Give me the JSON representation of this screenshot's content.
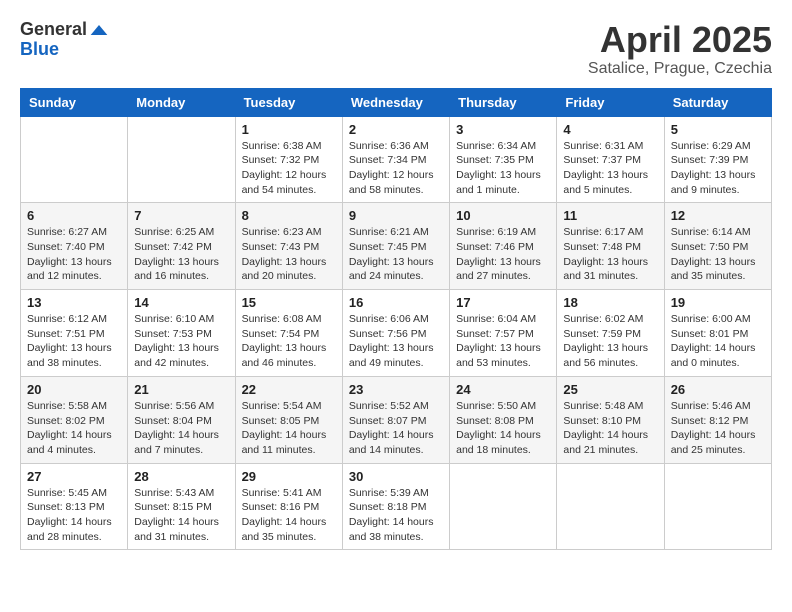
{
  "logo": {
    "general": "General",
    "blue": "Blue"
  },
  "title": "April 2025",
  "subtitle": "Satalice, Prague, Czechia",
  "days_of_week": [
    "Sunday",
    "Monday",
    "Tuesday",
    "Wednesday",
    "Thursday",
    "Friday",
    "Saturday"
  ],
  "weeks": [
    [
      {
        "day": "",
        "info": ""
      },
      {
        "day": "",
        "info": ""
      },
      {
        "day": "1",
        "info": "Sunrise: 6:38 AM\nSunset: 7:32 PM\nDaylight: 12 hours and 54 minutes."
      },
      {
        "day": "2",
        "info": "Sunrise: 6:36 AM\nSunset: 7:34 PM\nDaylight: 12 hours and 58 minutes."
      },
      {
        "day": "3",
        "info": "Sunrise: 6:34 AM\nSunset: 7:35 PM\nDaylight: 13 hours and 1 minute."
      },
      {
        "day": "4",
        "info": "Sunrise: 6:31 AM\nSunset: 7:37 PM\nDaylight: 13 hours and 5 minutes."
      },
      {
        "day": "5",
        "info": "Sunrise: 6:29 AM\nSunset: 7:39 PM\nDaylight: 13 hours and 9 minutes."
      }
    ],
    [
      {
        "day": "6",
        "info": "Sunrise: 6:27 AM\nSunset: 7:40 PM\nDaylight: 13 hours and 12 minutes."
      },
      {
        "day": "7",
        "info": "Sunrise: 6:25 AM\nSunset: 7:42 PM\nDaylight: 13 hours and 16 minutes."
      },
      {
        "day": "8",
        "info": "Sunrise: 6:23 AM\nSunset: 7:43 PM\nDaylight: 13 hours and 20 minutes."
      },
      {
        "day": "9",
        "info": "Sunrise: 6:21 AM\nSunset: 7:45 PM\nDaylight: 13 hours and 24 minutes."
      },
      {
        "day": "10",
        "info": "Sunrise: 6:19 AM\nSunset: 7:46 PM\nDaylight: 13 hours and 27 minutes."
      },
      {
        "day": "11",
        "info": "Sunrise: 6:17 AM\nSunset: 7:48 PM\nDaylight: 13 hours and 31 minutes."
      },
      {
        "day": "12",
        "info": "Sunrise: 6:14 AM\nSunset: 7:50 PM\nDaylight: 13 hours and 35 minutes."
      }
    ],
    [
      {
        "day": "13",
        "info": "Sunrise: 6:12 AM\nSunset: 7:51 PM\nDaylight: 13 hours and 38 minutes."
      },
      {
        "day": "14",
        "info": "Sunrise: 6:10 AM\nSunset: 7:53 PM\nDaylight: 13 hours and 42 minutes."
      },
      {
        "day": "15",
        "info": "Sunrise: 6:08 AM\nSunset: 7:54 PM\nDaylight: 13 hours and 46 minutes."
      },
      {
        "day": "16",
        "info": "Sunrise: 6:06 AM\nSunset: 7:56 PM\nDaylight: 13 hours and 49 minutes."
      },
      {
        "day": "17",
        "info": "Sunrise: 6:04 AM\nSunset: 7:57 PM\nDaylight: 13 hours and 53 minutes."
      },
      {
        "day": "18",
        "info": "Sunrise: 6:02 AM\nSunset: 7:59 PM\nDaylight: 13 hours and 56 minutes."
      },
      {
        "day": "19",
        "info": "Sunrise: 6:00 AM\nSunset: 8:01 PM\nDaylight: 14 hours and 0 minutes."
      }
    ],
    [
      {
        "day": "20",
        "info": "Sunrise: 5:58 AM\nSunset: 8:02 PM\nDaylight: 14 hours and 4 minutes."
      },
      {
        "day": "21",
        "info": "Sunrise: 5:56 AM\nSunset: 8:04 PM\nDaylight: 14 hours and 7 minutes."
      },
      {
        "day": "22",
        "info": "Sunrise: 5:54 AM\nSunset: 8:05 PM\nDaylight: 14 hours and 11 minutes."
      },
      {
        "day": "23",
        "info": "Sunrise: 5:52 AM\nSunset: 8:07 PM\nDaylight: 14 hours and 14 minutes."
      },
      {
        "day": "24",
        "info": "Sunrise: 5:50 AM\nSunset: 8:08 PM\nDaylight: 14 hours and 18 minutes."
      },
      {
        "day": "25",
        "info": "Sunrise: 5:48 AM\nSunset: 8:10 PM\nDaylight: 14 hours and 21 minutes."
      },
      {
        "day": "26",
        "info": "Sunrise: 5:46 AM\nSunset: 8:12 PM\nDaylight: 14 hours and 25 minutes."
      }
    ],
    [
      {
        "day": "27",
        "info": "Sunrise: 5:45 AM\nSunset: 8:13 PM\nDaylight: 14 hours and 28 minutes."
      },
      {
        "day": "28",
        "info": "Sunrise: 5:43 AM\nSunset: 8:15 PM\nDaylight: 14 hours and 31 minutes."
      },
      {
        "day": "29",
        "info": "Sunrise: 5:41 AM\nSunset: 8:16 PM\nDaylight: 14 hours and 35 minutes."
      },
      {
        "day": "30",
        "info": "Sunrise: 5:39 AM\nSunset: 8:18 PM\nDaylight: 14 hours and 38 minutes."
      },
      {
        "day": "",
        "info": ""
      },
      {
        "day": "",
        "info": ""
      },
      {
        "day": "",
        "info": ""
      }
    ]
  ]
}
